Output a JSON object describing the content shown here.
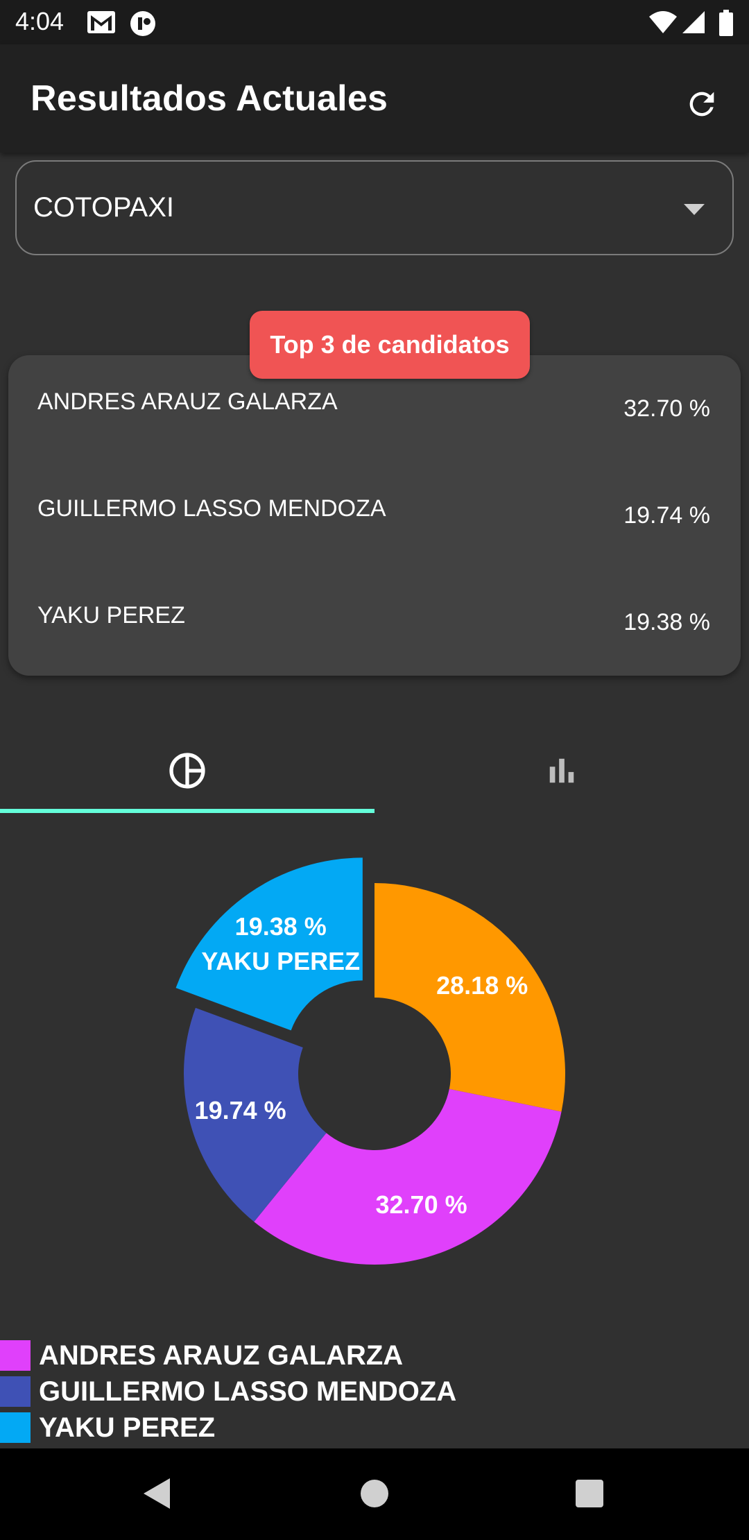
{
  "status_bar": {
    "time": "4:04",
    "icons": [
      "gmail-icon",
      "app-notification-icon",
      "wifi-icon",
      "signal-icon",
      "battery-icon"
    ]
  },
  "app_bar": {
    "title": "Resultados Actuales",
    "refresh_icon": "refresh-icon"
  },
  "province_select": {
    "value": "COTOPAXI",
    "caret_icon": "dropdown-arrow-icon"
  },
  "top3": {
    "badge": "Top 3 de candidatos",
    "candidates": [
      {
        "name": "ANDRES ARAUZ GALARZA",
        "percent": "32.70 %"
      },
      {
        "name": "GUILLERMO LASSO MENDOZA",
        "percent": "19.74 %"
      },
      {
        "name": "YAKU PEREZ",
        "percent": "19.38 %"
      }
    ]
  },
  "tabs": [
    {
      "icon": "pie-chart-icon",
      "selected": true
    },
    {
      "icon": "bar-chart-icon",
      "selected": false
    }
  ],
  "colors": {
    "background": "#303030",
    "app_bar": "#212121",
    "card": "#424242",
    "badge": "#f05454",
    "tab_indicator": "#64ffda"
  },
  "chart_data": {
    "type": "pie",
    "donut": true,
    "slices": [
      {
        "label": "28.18 %",
        "value": 28.18,
        "color": "#ff9800"
      },
      {
        "label": "32.70 %",
        "value": 32.7,
        "color": "#e040fb"
      },
      {
        "label": "19.74 %",
        "value": 19.74,
        "color": "#3f51b5"
      },
      {
        "label": "19.38 %",
        "value": 19.38,
        "color": "#03a9f4",
        "name": "YAKU PEREZ",
        "highlighted": true
      }
    ],
    "legend": [
      {
        "name": "ANDRES ARAUZ GALARZA",
        "color": "#e040fb"
      },
      {
        "name": "GUILLERMO LASSO MENDOZA",
        "color": "#3f51b5"
      },
      {
        "name": "YAKU PEREZ",
        "color": "#03a9f4"
      }
    ],
    "legend_position": "bottom-left"
  },
  "nav_bar": {
    "buttons": [
      "back-icon",
      "home-icon",
      "recents-icon"
    ]
  }
}
